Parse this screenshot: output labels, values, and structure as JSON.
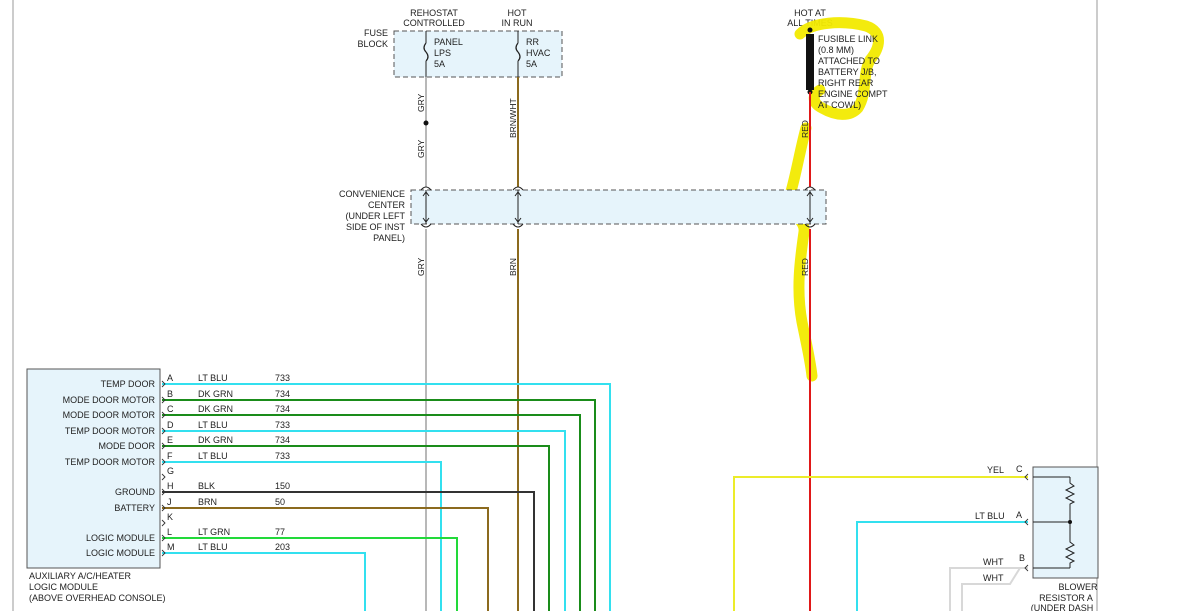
{
  "top": {
    "rheostat": [
      "REHOSTAT",
      "CONTROLLED"
    ],
    "hot_in_run": [
      "HOT",
      "IN RUN"
    ],
    "hot_at_all_times": [
      "HOT AT",
      "ALL TIMES"
    ]
  },
  "fuse_block": {
    "label": [
      "FUSE",
      "BLOCK"
    ],
    "fuses": [
      {
        "lines": [
          "PANEL",
          "LPS",
          "5A"
        ]
      },
      {
        "lines": [
          "RR",
          "HVAC",
          "5A"
        ]
      }
    ]
  },
  "fusible_link": {
    "lines": [
      "FUSIBLE LINK",
      "(0.8 MM)",
      "ATTACHED TO",
      "BATTERY J/B,",
      "RIGHT REAR",
      "ENGINE COMPT",
      "AT COWL)"
    ]
  },
  "convenience_center": {
    "lines": [
      "CONVENIENCE",
      "CENTER",
      "(UNDER LEFT",
      "SIDE OF INST",
      "PANEL)"
    ]
  },
  "wires": {
    "gry": "GRY",
    "brn_wht": "BRN/WHT",
    "brn": "BRN",
    "red": "RED"
  },
  "module": {
    "pins": [
      {
        "func": "TEMP DOOR",
        "pin": "A",
        "color": "LT BLU",
        "circuit": "733"
      },
      {
        "func": "MODE DOOR MOTOR",
        "pin": "B",
        "color": "DK GRN",
        "circuit": "734"
      },
      {
        "func": "MODE DOOR MOTOR",
        "pin": "C",
        "color": "DK GRN",
        "circuit": "734"
      },
      {
        "func": "TEMP DOOR MOTOR",
        "pin": "D",
        "color": "LT BLU",
        "circuit": "733"
      },
      {
        "func": "MODE DOOR",
        "pin": "E",
        "color": "DK GRN",
        "circuit": "734"
      },
      {
        "func": "TEMP DOOR MOTOR",
        "pin": "F",
        "color": "LT BLU",
        "circuit": "733"
      },
      {
        "func": "",
        "pin": "G",
        "color": "",
        "circuit": ""
      },
      {
        "func": "GROUND",
        "pin": "H",
        "color": "BLK",
        "circuit": "150"
      },
      {
        "func": "BATTERY",
        "pin": "J",
        "color": "BRN",
        "circuit": "50"
      },
      {
        "func": "",
        "pin": "K",
        "color": "",
        "circuit": ""
      },
      {
        "func": "LOGIC MODULE",
        "pin": "L",
        "color": "LT GRN",
        "circuit": "77"
      },
      {
        "func": "LOGIC MODULE",
        "pin": "M",
        "color": "LT BLU",
        "circuit": "203"
      }
    ],
    "caption": [
      "AUXILIARY A/C/HEATER",
      "LOGIC MODULE",
      "(ABOVE OVERHEAD CONSOLE)"
    ]
  },
  "blower": {
    "pins": [
      {
        "color": "YEL",
        "pin": "C"
      },
      {
        "color": "LT BLU",
        "pin": "A"
      },
      {
        "color": "WHT",
        "pin": "B"
      },
      {
        "color": "WHT",
        "pin": ""
      }
    ],
    "caption": [
      "BLOWER",
      "RESISTOR A",
      "(UNDER DASH"
    ]
  },
  "colors": {
    "lt_blu": "#33e0ef",
    "dk_grn": "#1a8c1a",
    "blk": "#333333",
    "brn": "#8b6a1e",
    "lt_grn": "#22d93a",
    "gry": "#b8b8b8",
    "red": "#e01818",
    "yel": "#ecec2a",
    "wht": "#d8d8d8",
    "highlight": "#f2ea00"
  }
}
